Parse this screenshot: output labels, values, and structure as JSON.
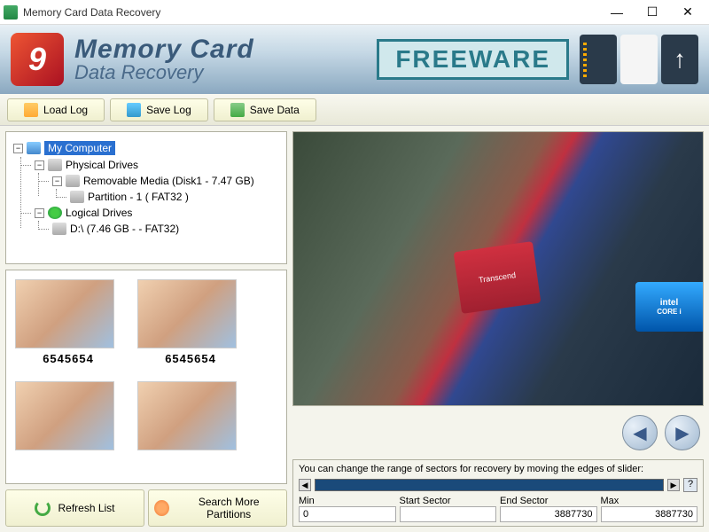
{
  "window": {
    "title": "Memory Card Data Recovery"
  },
  "header": {
    "title_line1": "Memory Card",
    "title_line2": "Data Recovery",
    "badge": "FREEWARE"
  },
  "toolbar": {
    "load_log": "Load Log",
    "save_log": "Save Log",
    "save_data": "Save Data"
  },
  "tree": {
    "root": "My Computer",
    "physical": "Physical Drives",
    "removable": "Removable Media (Disk1 - 7.47 GB)",
    "partition": "Partition - 1 ( FAT32 )",
    "logical": "Logical Drives",
    "drive_d": "D:\\ (7.46 GB -  - FAT32)"
  },
  "thumbnails": [
    {
      "label": "6545654"
    },
    {
      "label": "6545654"
    },
    {
      "label": ""
    },
    {
      "label": ""
    }
  ],
  "bottom_buttons": {
    "refresh": "Refresh List",
    "search": "Search More Partitions"
  },
  "preview": {
    "intel_brand": "intel",
    "intel_line": "CORE i",
    "sd_text": "Transcend"
  },
  "sectors": {
    "hint": "You can change the range of sectors for recovery by moving the edges of slider:",
    "min_label": "Min",
    "start_label": "Start Sector",
    "end_label": "End Sector",
    "max_label": "Max",
    "min": "0",
    "start": "",
    "end": "3887730",
    "max": "3887730",
    "help": "?"
  }
}
